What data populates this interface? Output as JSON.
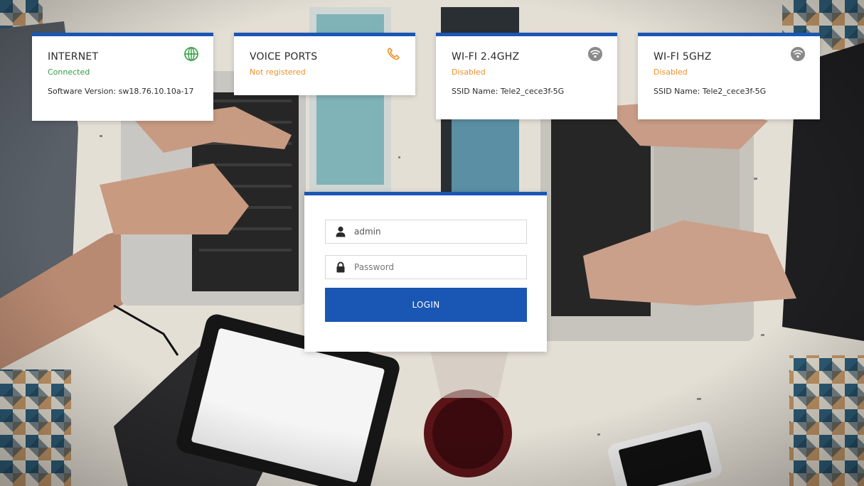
{
  "cards": [
    {
      "title": "INTERNET",
      "status": "Connected",
      "detail": "Software Version: sw18.76.10.10a-17",
      "icon": "globe-icon"
    },
    {
      "title": "VOICE PORTS",
      "status": "Not registered",
      "icon": "phone-icon"
    },
    {
      "title": "WI-FI 2.4GHZ",
      "status": "Disabled",
      "detail": "SSID Name: Tele2_cece3f-5G",
      "icon": "wifi-icon"
    },
    {
      "title": "WI-FI 5GHZ",
      "status": "Disabled",
      "detail": "SSID Name: Tele2_cece3f-5G",
      "icon": "wifi-icon"
    }
  ],
  "login": {
    "username_value": "admin",
    "password_placeholder": "Password",
    "button_label": "LOGIN"
  },
  "colors": {
    "accent": "#1a56b3",
    "status_ok": "#2e9e3e",
    "status_warn": "#f0902a",
    "wifi_icon": "#8a8a8a"
  }
}
